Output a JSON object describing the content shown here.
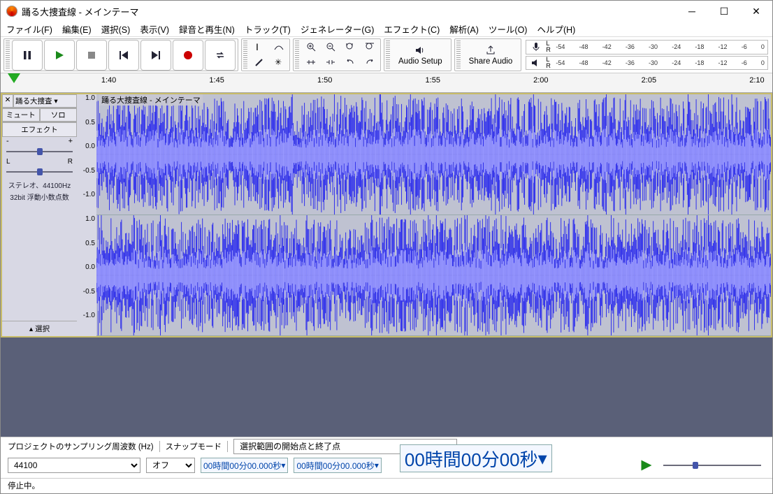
{
  "title": "踊る大捜査線 - メインテーマ",
  "menu": [
    "ファイル(F)",
    "編集(E)",
    "選択(S)",
    "表示(V)",
    "録音と再生(N)",
    "トラック(T)",
    "ジェネレーター(G)",
    "エフェクト(C)",
    "解析(A)",
    "ツール(O)",
    "ヘルプ(H)"
  ],
  "toolbar_big": {
    "audio_setup": "Audio Setup",
    "share_audio": "Share Audio"
  },
  "meter_ticks": [
    "-54",
    "-48",
    "-42",
    "-36",
    "-30",
    "-24",
    "-18",
    "-12",
    "-6",
    "0"
  ],
  "lr": {
    "l": "L",
    "r": "R"
  },
  "timeline_labels": [
    "1:40",
    "1:45",
    "1:50",
    "1:55",
    "2:00",
    "2:05",
    "2:10"
  ],
  "track": {
    "name": "踊る大捜査",
    "header": "踊る大捜査線 - メインテーマ",
    "mute": "ミュート",
    "solo": "ソロ",
    "effect": "エフェクト",
    "info1": "ステレオ、44100Hz",
    "info2": "32bit 浮動小数点数",
    "select": "選択",
    "scale": [
      "1.0",
      "0.5",
      "0.0",
      "-0.5",
      "-1.0"
    ]
  },
  "bottom_labels": {
    "samplerate_label": "プロジェクトのサンプリング周波数 (Hz)",
    "snap_label": "スナップモード",
    "sel_label": "選択範囲の開始点と終了点"
  },
  "bottom": {
    "sample_rate": "44100",
    "snap_mode": "オフ",
    "time1": "00時間00分00.000秒",
    "time2": "00時間00分00.000秒",
    "bigtime": "00時間00分00秒"
  },
  "status": "停止中。"
}
